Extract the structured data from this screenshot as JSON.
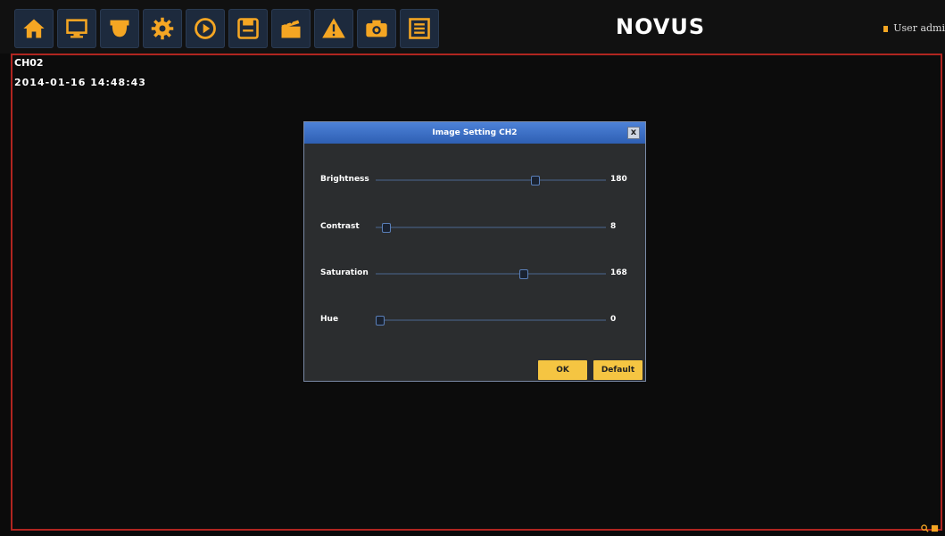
{
  "toolbar": {
    "items": [
      {
        "icon": "home-icon"
      },
      {
        "icon": "monitor-icon"
      },
      {
        "icon": "camera-ptz-icon"
      },
      {
        "icon": "gear-icon"
      },
      {
        "icon": "play-icon"
      },
      {
        "icon": "save-icon"
      },
      {
        "icon": "clapper-icon"
      },
      {
        "icon": "warning-icon"
      },
      {
        "icon": "camera-icon"
      },
      {
        "icon": "list-icon"
      }
    ],
    "accent": "#f5a623"
  },
  "brand": {
    "logo": "NOVUS"
  },
  "user": {
    "label": "User admi"
  },
  "live": {
    "channel": "CH02",
    "timestamp": "2014-01-16 14:48:43"
  },
  "dialog": {
    "title": "Image Setting CH2",
    "close_label": "x",
    "sliders": [
      {
        "label": "Brightness",
        "value": "180",
        "level": 0.7
      },
      {
        "label": "Contrast",
        "value": "8",
        "level": 0.03
      },
      {
        "label": "Saturation",
        "value": "168",
        "level": 0.65
      },
      {
        "label": "Hue",
        "value": "0",
        "level": 0.0
      }
    ],
    "ok_label": "OK",
    "default_label": "Default"
  }
}
